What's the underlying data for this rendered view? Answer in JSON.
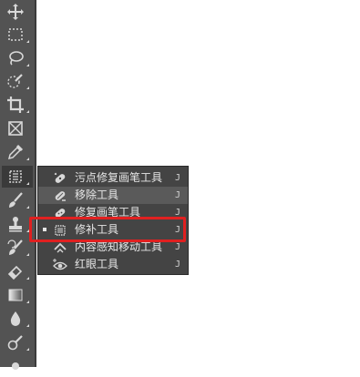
{
  "colors": {
    "toolbar_bg": "#535353",
    "flyout_bg": "#444444",
    "hover_bg": "#5a5a5a",
    "text": "#e6e6e6",
    "highlight": "#e02020"
  },
  "toolbar": {
    "tools": [
      {
        "name": "move-tool",
        "icon": "move-icon"
      },
      {
        "name": "marquee-tool",
        "icon": "rect-marquee-icon"
      },
      {
        "name": "lasso-tool",
        "icon": "lasso-icon"
      },
      {
        "name": "quick-select-tool",
        "icon": "quick-select-icon"
      },
      {
        "name": "crop-tool",
        "icon": "crop-icon"
      },
      {
        "name": "frame-tool",
        "icon": "frame-icon"
      },
      {
        "name": "eyedropper-tool",
        "icon": "eyedropper-icon"
      },
      {
        "name": "patch-tool",
        "icon": "patch-icon",
        "active": true
      },
      {
        "name": "brush-tool",
        "icon": "brush-icon"
      },
      {
        "name": "stamp-tool",
        "icon": "stamp-icon"
      },
      {
        "name": "history-brush-tool",
        "icon": "history-brush-icon"
      },
      {
        "name": "eraser-tool",
        "icon": "eraser-icon"
      },
      {
        "name": "gradient-tool",
        "icon": "gradient-icon"
      },
      {
        "name": "blur-tool",
        "icon": "drop-icon"
      },
      {
        "name": "dodge-tool",
        "icon": "dodge-icon"
      }
    ]
  },
  "flyout": {
    "items": [
      {
        "label": "污点修复画笔工具",
        "shortcut": "J",
        "icon": "spot-healing-brush-icon",
        "selected": false
      },
      {
        "label": "移除工具",
        "shortcut": "J",
        "icon": "remove-tool-icon",
        "selected": false,
        "hover": true
      },
      {
        "label": "修复画笔工具",
        "shortcut": "J",
        "icon": "healing-brush-icon",
        "selected": false
      },
      {
        "label": "修补工具",
        "shortcut": "J",
        "icon": "patch-icon",
        "selected": true
      },
      {
        "label": "内容感知移动工具",
        "shortcut": "J",
        "icon": "content-aware-move-icon",
        "selected": false
      },
      {
        "label": "红眼工具",
        "shortcut": "J",
        "icon": "red-eye-icon",
        "selected": false
      }
    ]
  }
}
